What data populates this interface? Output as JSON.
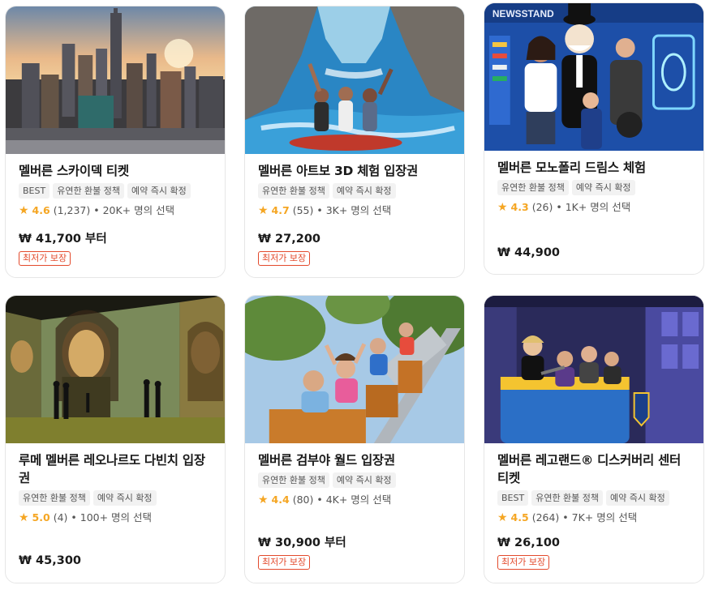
{
  "cards": [
    {
      "title": "멜버른 스카이덱 티켓",
      "tags": [
        "BEST",
        "유연한 환불 정책",
        "예약 즉시 확정"
      ],
      "rating": "4.6",
      "reviews": "(1,237)",
      "booked": "• 20K+ 명의 선택",
      "price": "₩ 41,700 부터",
      "badge": "최저가 보장",
      "image": "melbourne-skyline-photo"
    },
    {
      "title": "멜버른 아트보 3D 체험 입장권",
      "tags": [
        "유연한 환불 정책",
        "예약 즉시 확정"
      ],
      "rating": "4.7",
      "reviews": "(55)",
      "booked": "• 3K+ 명의 선택",
      "price": "₩ 27,200",
      "badge": "최저가 보장",
      "image": "3d-art-rafting-photo"
    },
    {
      "title": "멜버른 모노폴리 드림스 체험",
      "tags": [
        "유연한 환불 정책",
        "예약 즉시 확정"
      ],
      "rating": "4.3",
      "reviews": "(26)",
      "booked": "• 1K+ 명의 선택",
      "price": "₩ 44,900",
      "badge": "",
      "image": "monopoly-newsstand-photo",
      "image_text": "NEWSSTAND"
    },
    {
      "title": "루메 멜버른 레오나르도 다빈치 입장권",
      "tags": [
        "유연한 환불 정책",
        "예약 즉시 확정"
      ],
      "rating": "5.0",
      "reviews": "(4)",
      "booked": "• 100+ 명의 선택",
      "price": "₩ 45,300",
      "badge": "",
      "image": "mona-lisa-projection-photo"
    },
    {
      "title": "멜버른 검부야 월드 입장권",
      "tags": [
        "유연한 환불 정책",
        "예약 즉시 확정"
      ],
      "rating": "4.4",
      "reviews": "(80)",
      "booked": "• 4K+ 명의 선택",
      "price": "₩ 30,900 부터",
      "badge": "최저가 보장",
      "image": "rollercoaster-photo"
    },
    {
      "title": "멜버른 레고랜드® 디스커버리 센터 티켓",
      "tags": [
        "BEST",
        "유연한 환불 정책",
        "예약 즉시 확정"
      ],
      "rating": "4.5",
      "reviews": "(264)",
      "booked": "• 7K+ 명의 선택",
      "price": "₩ 26,100",
      "badge": "최저가 보장",
      "image": "legoland-ride-photo"
    }
  ]
}
